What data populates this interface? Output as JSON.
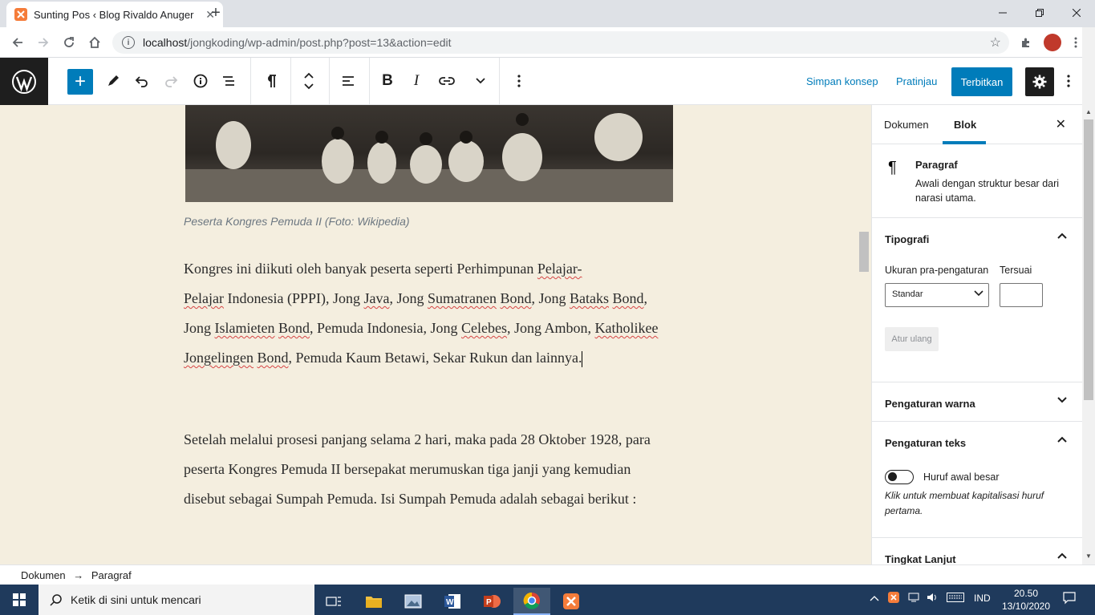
{
  "browser": {
    "tab_title": "Sunting Pos ‹ Blog Rivaldo Anugerah",
    "tab_close": "✕",
    "new_tab": "+",
    "url_host": "localhost",
    "url_path": "/jongkoding/wp-admin/post.php?post=13&action=edit"
  },
  "toolbar": {
    "save_draft": "Simpan konsep",
    "preview": "Pratinjau",
    "publish": "Terbitkan"
  },
  "editor": {
    "caption": "Peserta Kongres Pemuda II (Foto: Wikipedia)",
    "paragraph1": {
      "p01": "Kongres ini diikuti oleh banyak peserta seperti Perhimpunan ",
      "p02": "Pelajar-",
      "p03": "Pelajar",
      "p04": " Indonesia (PPPI), Jong ",
      "p05": "Java",
      "p06": ", Jong ",
      "p07": "Sumatranen",
      "p08": " ",
      "p09": "Bond",
      "p10": ", Jong ",
      "p11": "Bataks",
      "p12": "Bond",
      "p13": ", Jong ",
      "p14": "Islamieten",
      "p15": " ",
      "p16": "Bond",
      "p17": ", Pemuda Indonesia, Jong ",
      "p18": "Celebes",
      "p19": ", Jong Ambon, ",
      "p20": "Katholikee",
      "p21": " ",
      "p22": "Jongelingen",
      "p23": " ",
      "p24": "Bond",
      "p25": ", Pemuda Kaum Betawi, Sekar Rukun dan lainnya."
    },
    "paragraph2": "Setelah melalui prosesi panjang selama 2 hari, maka pada 28 Oktober 1928, para peserta Kongres Pemuda II bersepakat merumuskan tiga janji yang kemudian disebut sebagai Sumpah Pemuda. Isi Sumpah Pemuda adalah sebagai berikut :"
  },
  "sidebar": {
    "tab_document": "Dokumen",
    "tab_block": "Blok",
    "block_name": "Paragraf",
    "block_desc": "Awali dengan struktur besar dari narasi utama.",
    "typography_title": "Tipografi",
    "preset_size_label": "Ukuran pra-pengaturan",
    "custom_label": "Tersuai",
    "preset_selected": "Standar",
    "reset_button": "Atur ulang",
    "color_settings": "Pengaturan warna",
    "text_settings": "Pengaturan teks",
    "dropcap_label": "Huruf awal besar",
    "dropcap_help": "Klik untuk membuat kapitalisasi huruf pertama.",
    "advanced": "Tingkat Lanjut"
  },
  "footer": {
    "crumb_document": "Dokumen",
    "crumb_arrow": "→",
    "crumb_block": "Paragraf"
  },
  "taskbar": {
    "search_placeholder": "Ketik di sini untuk mencari",
    "language": "IND",
    "time": "20.50",
    "date": "13/10/2020"
  },
  "colors": {
    "wp_blue": "#007cba",
    "editor_bg": "#f4eedf",
    "taskbar_bg": "#1f3a5c"
  }
}
